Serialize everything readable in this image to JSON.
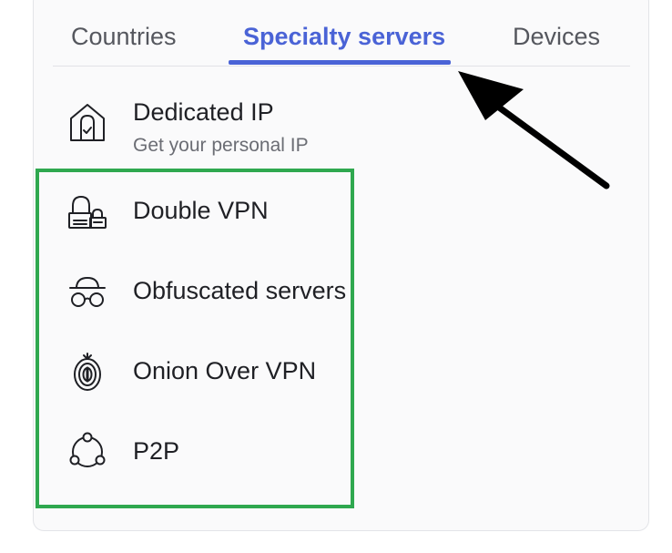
{
  "tabs": {
    "countries": "Countries",
    "specialty": "Specialty servers",
    "devices": "Devices",
    "active": "specialty"
  },
  "items": [
    {
      "icon": "house-lock-icon",
      "label": "Dedicated IP",
      "sublabel": "Get your personal IP"
    },
    {
      "icon": "double-lock-icon",
      "label": "Double VPN"
    },
    {
      "icon": "incognito-icon",
      "label": "Obfuscated servers"
    },
    {
      "icon": "onion-icon",
      "label": "Onion Over VPN"
    },
    {
      "icon": "p2p-network-icon",
      "label": "P2P"
    }
  ],
  "colors": {
    "accent": "#4a63d6",
    "highlight": "#2fa84f",
    "annotation_arrow": "#000000"
  }
}
